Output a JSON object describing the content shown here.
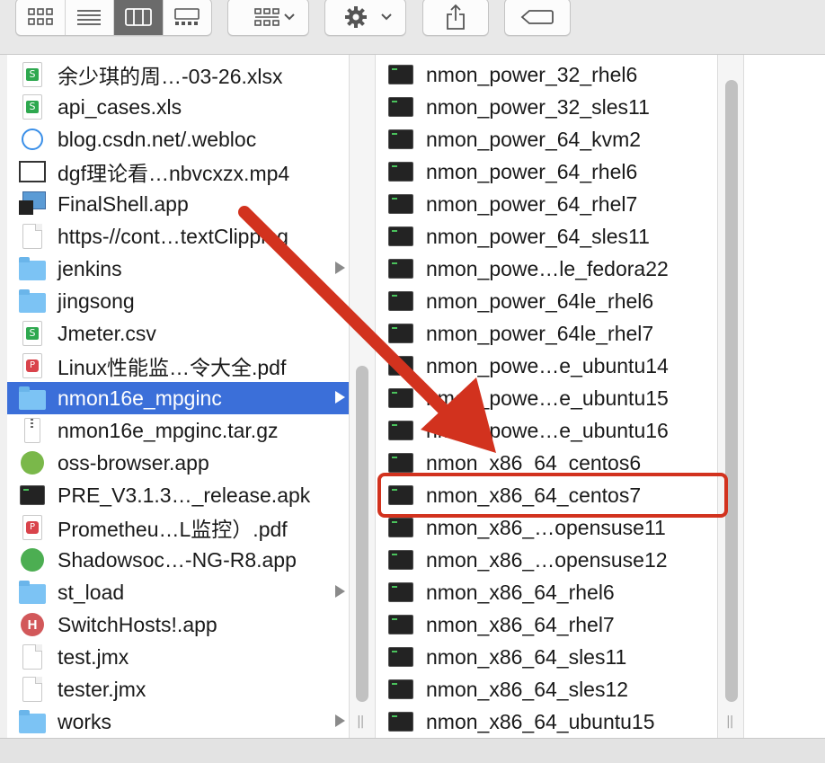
{
  "toolbar": {
    "view_buttons": [
      {
        "icon": "icon-view-icon",
        "active": false
      },
      {
        "icon": "list-view-icon",
        "active": false
      },
      {
        "icon": "column-view-icon",
        "active": true
      },
      {
        "icon": "gallery-view-icon",
        "active": false
      }
    ],
    "group_icon": "group-icon",
    "action_icon": "gear-icon",
    "share_icon": "share-icon",
    "tag_icon": "tag-icon"
  },
  "left_column": {
    "items": [
      {
        "name": "余少琪的周…-03-26.xlsx",
        "icon": "xlsx",
        "selected": false,
        "folder": false
      },
      {
        "name": "api_cases.xls",
        "icon": "xlsx",
        "selected": false,
        "folder": false
      },
      {
        "name": "blog.csdn.net/.webloc",
        "icon": "webloc",
        "selected": false,
        "folder": false
      },
      {
        "name": "dgf理论看…nbvcxzx.mp4",
        "icon": "video",
        "selected": false,
        "folder": false
      },
      {
        "name": "FinalShell.app",
        "icon": "app",
        "selected": false,
        "folder": false
      },
      {
        "name": "https-//cont…textClipping",
        "icon": "doc",
        "selected": false,
        "folder": false
      },
      {
        "name": "jenkins",
        "icon": "folder",
        "selected": false,
        "folder": true
      },
      {
        "name": "jingsong",
        "icon": "folder",
        "selected": false,
        "folder": false
      },
      {
        "name": "Jmeter.csv",
        "icon": "xlsx",
        "selected": false,
        "folder": false
      },
      {
        "name": "Linux性能监…令大全.pdf",
        "icon": "pdf",
        "selected": false,
        "folder": false
      },
      {
        "name": "nmon16e_mpginc",
        "icon": "folder",
        "selected": true,
        "folder": true
      },
      {
        "name": "nmon16e_mpginc.tar.gz",
        "icon": "gz",
        "selected": false,
        "folder": false
      },
      {
        "name": "oss-browser.app",
        "icon": "oss",
        "selected": false,
        "folder": false
      },
      {
        "name": "PRE_V3.1.3…_release.apk",
        "icon": "terminal",
        "selected": false,
        "folder": false
      },
      {
        "name": "Prometheu…L监控）.pdf",
        "icon": "pdf",
        "selected": false,
        "folder": false
      },
      {
        "name": "Shadowsoc…-NG-R8.app",
        "icon": "shadowsocks",
        "selected": false,
        "folder": false
      },
      {
        "name": "st_load",
        "icon": "folder",
        "selected": false,
        "folder": true
      },
      {
        "name": "SwitchHosts!.app",
        "icon": "switchhosts",
        "selected": false,
        "folder": false
      },
      {
        "name": "test.jmx",
        "icon": "doc",
        "selected": false,
        "folder": false
      },
      {
        "name": "tester.jmx",
        "icon": "doc",
        "selected": false,
        "folder": false
      },
      {
        "name": "works",
        "icon": "folder",
        "selected": false,
        "folder": true
      }
    ]
  },
  "right_column": {
    "items": [
      {
        "name": "nmon_power_32_rhel6",
        "highlighted": false
      },
      {
        "name": "nmon_power_32_sles11",
        "highlighted": false
      },
      {
        "name": "nmon_power_64_kvm2",
        "highlighted": false
      },
      {
        "name": "nmon_power_64_rhel6",
        "highlighted": false
      },
      {
        "name": "nmon_power_64_rhel7",
        "highlighted": false
      },
      {
        "name": "nmon_power_64_sles11",
        "highlighted": false
      },
      {
        "name": "nmon_powe…le_fedora22",
        "highlighted": false
      },
      {
        "name": "nmon_power_64le_rhel6",
        "highlighted": false
      },
      {
        "name": "nmon_power_64le_rhel7",
        "highlighted": false
      },
      {
        "name": "nmon_powe…e_ubuntu14",
        "highlighted": false
      },
      {
        "name": "nmon_powe…e_ubuntu15",
        "highlighted": false
      },
      {
        "name": "nmon_powe…e_ubuntu16",
        "highlighted": false
      },
      {
        "name": "nmon_x86_64_centos6",
        "highlighted": false
      },
      {
        "name": "nmon_x86_64_centos7",
        "highlighted": true
      },
      {
        "name": "nmon_x86_…opensuse11",
        "highlighted": false
      },
      {
        "name": "nmon_x86_…opensuse12",
        "highlighted": false
      },
      {
        "name": "nmon_x86_64_rhel6",
        "highlighted": false
      },
      {
        "name": "nmon_x86_64_rhel7",
        "highlighted": false
      },
      {
        "name": "nmon_x86_64_sles11",
        "highlighted": false
      },
      {
        "name": "nmon_x86_64_sles12",
        "highlighted": false
      },
      {
        "name": "nmon_x86_64_ubuntu15",
        "highlighted": false
      }
    ]
  },
  "colors": {
    "selection": "#3b6fd9",
    "annotation": "#d2321e",
    "toolbar_bg": "#e8e8e8",
    "folder": "#7cc3f4"
  }
}
